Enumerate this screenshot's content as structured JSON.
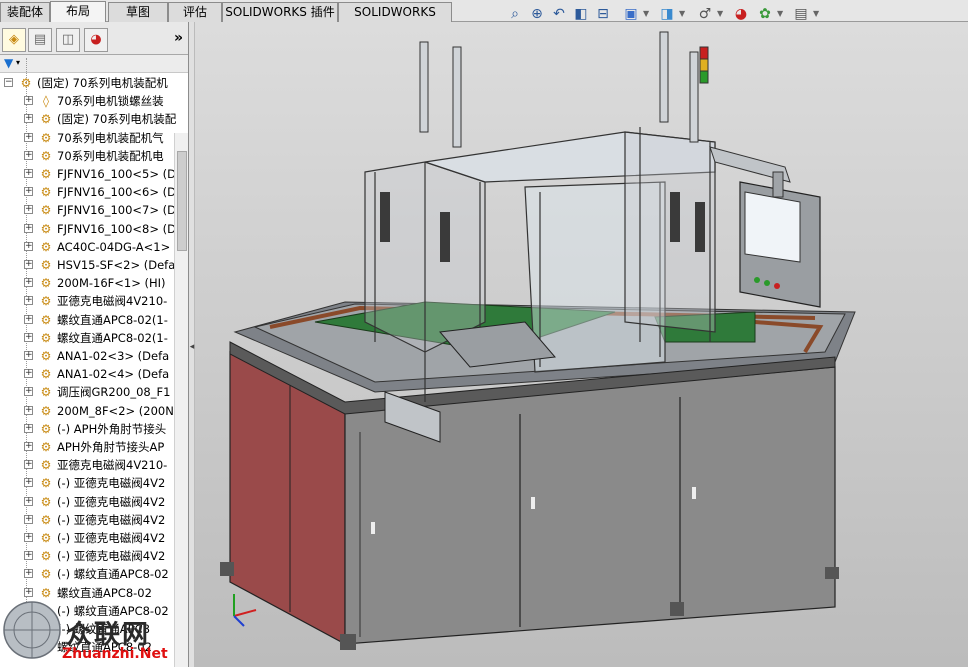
{
  "tabs": [
    {
      "label": "装配体",
      "active": false
    },
    {
      "label": "布局",
      "active": true
    },
    {
      "label": "草图",
      "active": false
    },
    {
      "label": "评估",
      "active": false
    },
    {
      "label": "SOLIDWORKS 插件",
      "active": false
    },
    {
      "label": "SOLIDWORKS MBD",
      "active": false
    }
  ],
  "view_toolbar": [
    "zoom-to-fit-icon",
    "zoom-to-area-icon",
    "previous-view-icon",
    "section-view-icon",
    "view-orientation-icon",
    "display-style-icon",
    "hide-show-items-icon",
    "edit-appearance-icon",
    "apply-scene-icon",
    "view-settings-icon"
  ],
  "feature_manager": {
    "expand_label": "»",
    "tree": [
      {
        "text": "(固定) 70系列电机装配机",
        "level": 0
      },
      {
        "text": "70系列电机锁螺丝装",
        "level": 1,
        "icon": "part"
      },
      {
        "text": "(固定) 70系列电机装配",
        "level": 1
      },
      {
        "text": "70系列电机装配机气",
        "level": 1
      },
      {
        "text": "70系列电机装配机电",
        "level": 1
      },
      {
        "text": "FJFNV16_100<5> (D",
        "level": 1
      },
      {
        "text": "FJFNV16_100<6> (D",
        "level": 1
      },
      {
        "text": "FJFNV16_100<7> (D",
        "level": 1
      },
      {
        "text": "FJFNV16_100<8> (D",
        "level": 1
      },
      {
        "text": "AC40C-04DG-A<1>",
        "level": 1
      },
      {
        "text": "HSV15-SF<2> (Defa",
        "level": 1
      },
      {
        "text": "200M-16F<1> (HI)",
        "level": 1
      },
      {
        "text": "亚德克电磁阀4V210-",
        "level": 1
      },
      {
        "text": "螺纹直通APC8-02(1-",
        "level": 1
      },
      {
        "text": "螺纹直通APC8-02(1-",
        "level": 1
      },
      {
        "text": "ANA1-02<3> (Defa",
        "level": 1
      },
      {
        "text": "ANA1-02<4> (Defa",
        "level": 1
      },
      {
        "text": "调压阀GR200_08_F1",
        "level": 1
      },
      {
        "text": "200M_8F<2> (200N",
        "level": 1
      },
      {
        "text": "(-) APH外角肘节接头",
        "level": 1
      },
      {
        "text": "APH外角肘节接头AP",
        "level": 1
      },
      {
        "text": "亚德克电磁阀4V210-",
        "level": 1
      },
      {
        "text": "(-) 亚德克电磁阀4V2",
        "level": 1
      },
      {
        "text": "(-) 亚德克电磁阀4V2",
        "level": 1
      },
      {
        "text": "(-) 亚德克电磁阀4V2",
        "level": 1
      },
      {
        "text": "(-) 亚德克电磁阀4V2",
        "level": 1
      },
      {
        "text": "(-) 亚德克电磁阀4V2",
        "level": 1
      },
      {
        "text": "(-) 螺纹直通APC8-02",
        "level": 1
      },
      {
        "text": "螺纹直通APC8-02",
        "level": 1
      },
      {
        "text": "(-) 螺纹直通APC8-02",
        "level": 1
      },
      {
        "text": "(-) 螺纹直通APC8",
        "level": 1
      },
      {
        "text": "螺纹直通APC8-02",
        "level": 1
      }
    ]
  },
  "watermark": {
    "text": "众联网",
    "url": "Zhuanzhi.Net"
  },
  "colors": {
    "cabinet_gray": "#8a8a8a",
    "door_red": "#9a4a4a",
    "frame_silver": "#c8ccd0",
    "plate_green": "#2f7a3a",
    "accent_blue": "#1a6fcf"
  }
}
